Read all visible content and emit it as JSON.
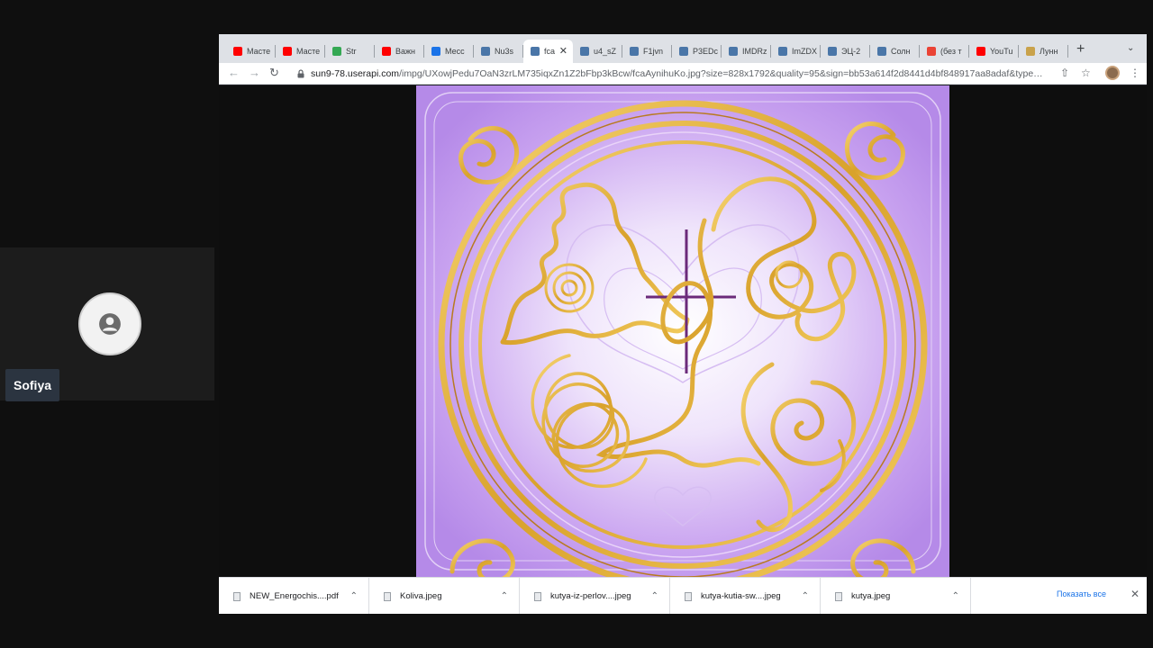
{
  "participant": {
    "name": "Sofiya"
  },
  "browser": {
    "tabs": [
      {
        "label": "Масте",
        "icon": "youtube-icon",
        "color": "#ff0000",
        "active": false
      },
      {
        "label": "Масте",
        "icon": "youtube-icon",
        "color": "#ff0000",
        "active": false
      },
      {
        "label": "Str",
        "icon": "generic-icon",
        "color": "#34a853",
        "active": false
      },
      {
        "label": "Важн",
        "icon": "youtube-icon",
        "color": "#ff0000",
        "active": false
      },
      {
        "label": "Месс",
        "icon": "messenger-icon",
        "color": "#1a73e8",
        "active": false
      },
      {
        "label": "Nu3s",
        "icon": "vk-icon",
        "color": "#4a76a8",
        "active": false
      },
      {
        "label": "fca",
        "icon": "vk-icon",
        "color": "#4a76a8",
        "active": true
      },
      {
        "label": "u4_sZ",
        "icon": "vk-icon",
        "color": "#4a76a8",
        "active": false
      },
      {
        "label": "F1jvn",
        "icon": "vk-icon",
        "color": "#4a76a8",
        "active": false
      },
      {
        "label": "P3EDc",
        "icon": "vk-icon",
        "color": "#4a76a8",
        "active": false
      },
      {
        "label": "IMDRz",
        "icon": "vk-icon",
        "color": "#4a76a8",
        "active": false
      },
      {
        "label": "ImZDX",
        "icon": "vk-icon",
        "color": "#4a76a8",
        "active": false
      },
      {
        "label": "ЭЦ-2",
        "icon": "vk-icon",
        "color": "#4a76a8",
        "active": false
      },
      {
        "label": "Солн",
        "icon": "vk-icon",
        "color": "#4a76a8",
        "active": false
      },
      {
        "label": "(без т",
        "icon": "gmail-icon",
        "color": "#ea4335",
        "active": false
      },
      {
        "label": "YouTu",
        "icon": "youtube-icon",
        "color": "#ff0000",
        "active": false
      },
      {
        "label": "Лунн",
        "icon": "moon-icon",
        "color": "#c9a24b",
        "active": false
      }
    ],
    "url_host": "sun9-78.userapi.com",
    "url_path": "/impg/UXowjPedu7OaN3zrLM735iqxZn1Z2bFbp3kBcw/fcaAynihuKo.jpg?size=828x1792&quality=95&sign=bb53a614f2d8441d4bf848917aa8adaf&type…"
  },
  "downloads": {
    "items": [
      {
        "name": "NEW_Energochis....pdf"
      },
      {
        "name": "Koliva.jpeg"
      },
      {
        "name": "kutya-iz-perlov....jpeg"
      },
      {
        "name": "kutya-kutia-sw....jpeg"
      },
      {
        "name": "kutya.jpeg"
      }
    ],
    "show_all": "Показать все"
  },
  "colors": {
    "accent": "#1a73e8",
    "artwork_bg": "#c9a3f0",
    "gold": "#e3b437"
  }
}
